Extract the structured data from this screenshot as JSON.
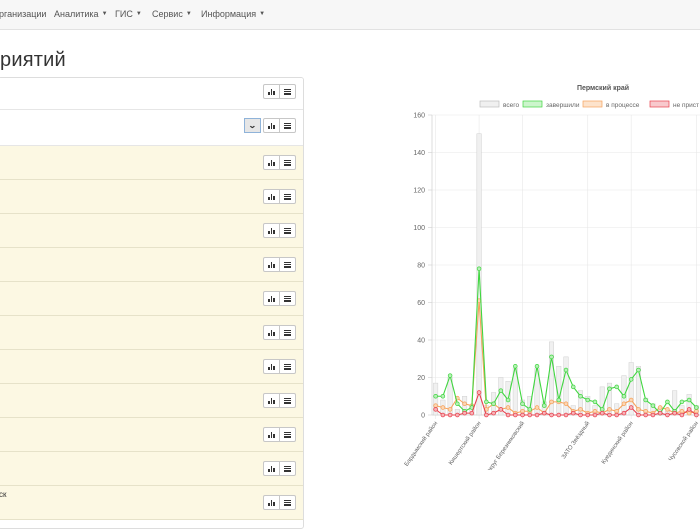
{
  "navbar": {
    "items": [
      {
        "label": "рганизации",
        "caret": false
      },
      {
        "label": "Аналитика",
        "caret": true
      },
      {
        "label": "ГИС",
        "caret": true
      },
      {
        "label": "Сервис",
        "caret": true
      },
      {
        "label": "Информация",
        "caret": true
      }
    ]
  },
  "page": {
    "title": "риятий"
  },
  "panel": {
    "last_row_label": "ск"
  },
  "icons": {
    "chart_button": "bar-chart-icon",
    "list_button": "list-icon",
    "toggle_button": "chevron-down-icon",
    "caret": "caret-down-icon"
  },
  "chart_data": {
    "type": "bar",
    "title": "Пермский край",
    "ylim": [
      0,
      160
    ],
    "yticks": [
      0,
      20,
      40,
      60,
      80,
      100,
      120,
      140,
      160
    ],
    "grid": true,
    "legend_position": "top",
    "visible_xlabels": [
      {
        "index": 0,
        "label": "Бардымский район"
      },
      {
        "index": 6,
        "label": "Кишертский район"
      },
      {
        "index": 12,
        "label": "городской округ Березниковский"
      },
      {
        "index": 21,
        "label": "ЗАТО Звёздный"
      },
      {
        "index": 27,
        "label": "Куединский район"
      },
      {
        "index": 36,
        "label": "Чусовской район"
      }
    ],
    "series": [
      {
        "name": "всего",
        "kind": "bar",
        "color": "#bdbdbd",
        "values": [
          17,
          8,
          20,
          3,
          10,
          5,
          150,
          5,
          12,
          20,
          18,
          25,
          8,
          10,
          25,
          7,
          39,
          26,
          31,
          5,
          13,
          10,
          5,
          15,
          17,
          6,
          21,
          28,
          26,
          9,
          6,
          4,
          2,
          13,
          5,
          11,
          5
        ]
      },
      {
        "name": "завершили",
        "kind": "line",
        "color": "#40d640",
        "values": [
          10,
          10,
          21,
          6,
          2,
          4,
          78,
          7,
          6,
          13,
          8,
          26,
          6,
          3,
          26,
          5,
          31,
          8,
          24,
          15,
          10,
          8,
          7,
          3,
          14,
          15,
          10,
          19,
          24,
          8,
          5,
          1,
          7,
          2,
          7,
          8,
          4
        ]
      },
      {
        "name": "в процессе",
        "kind": "line",
        "color": "#f6a35c",
        "values": [
          5,
          4,
          3,
          9,
          6,
          5,
          61,
          3,
          6,
          3,
          4,
          1,
          2,
          2,
          4,
          1,
          7,
          7,
          6,
          2,
          3,
          1,
          2,
          1,
          3,
          2,
          6,
          8,
          3,
          2,
          1,
          4,
          3,
          1,
          2,
          1,
          2
        ]
      },
      {
        "name": "не приступили",
        "kind": "line",
        "color": "#e8404d",
        "values": [
          3,
          0,
          0,
          0,
          1,
          1,
          12,
          0,
          1,
          3,
          0,
          0,
          0,
          0,
          0,
          1,
          0,
          0,
          0,
          1,
          0,
          0,
          0,
          1,
          0,
          0,
          1,
          4,
          0,
          0,
          0,
          1,
          0,
          1,
          0,
          3,
          0
        ]
      }
    ],
    "legend_labels": [
      "всего",
      "завершили",
      "в процессе",
      "не прист"
    ]
  }
}
